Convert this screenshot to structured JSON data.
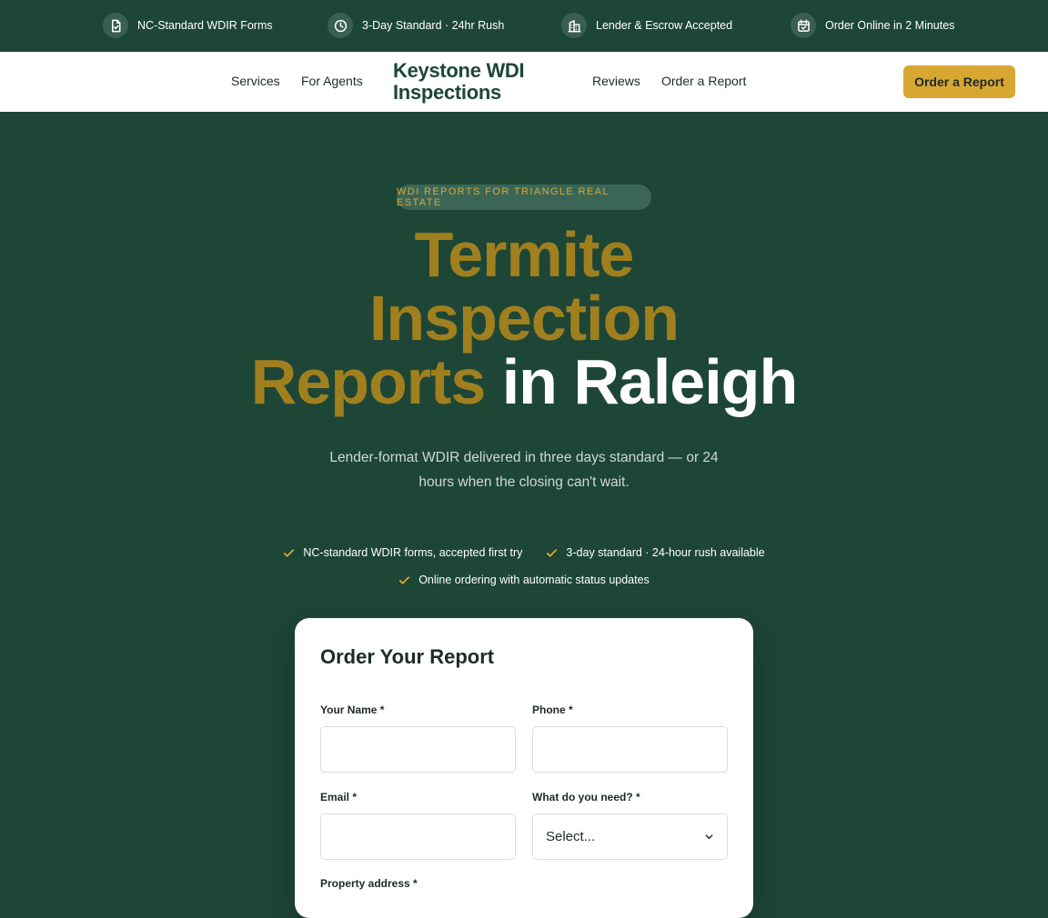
{
  "topbar": {
    "items": [
      {
        "icon": "document-check-icon",
        "label": "NC-Standard WDIR Forms"
      },
      {
        "icon": "clock-icon",
        "label": "3-Day Standard · 24hr Rush"
      },
      {
        "icon": "building-icon",
        "label": "Lender & Escrow Accepted"
      },
      {
        "icon": "calendar-check-icon",
        "label": "Order Online in 2 Minutes"
      }
    ]
  },
  "nav": {
    "links": [
      "Services",
      "For Agents",
      "Reviews",
      "Order a Report"
    ],
    "logo_line1": "Keystone WDI",
    "logo_line2": "Inspections",
    "cta": "Order a Report"
  },
  "hero": {
    "eyebrow": "WDI REPORTS FOR TRIANGLE REAL ESTATE",
    "headline_line1": "Termite",
    "headline_line2": "Inspection",
    "headline_line3_gold": "Reports",
    "headline_line3_white": "in Raleigh",
    "subtext": "Lender-format WDIR delivered in three days standard — or 24 hours when the closing can't wait.",
    "checks": [
      "NC-standard WDIR forms, accepted first try",
      "3-day standard · 24-hour rush available",
      "Online ordering with automatic status updates"
    ]
  },
  "form": {
    "title": "Order Your Report",
    "name_label": "Your Name *",
    "phone_label": "Phone *",
    "email_label": "Email *",
    "need_label": "What do you need? *",
    "need_selected": "Select...",
    "address_label": "Property address *"
  },
  "colors": {
    "brand_green": "#1d4637",
    "accent_gold": "#d7a732",
    "headline_gold": "#a07f1e"
  }
}
